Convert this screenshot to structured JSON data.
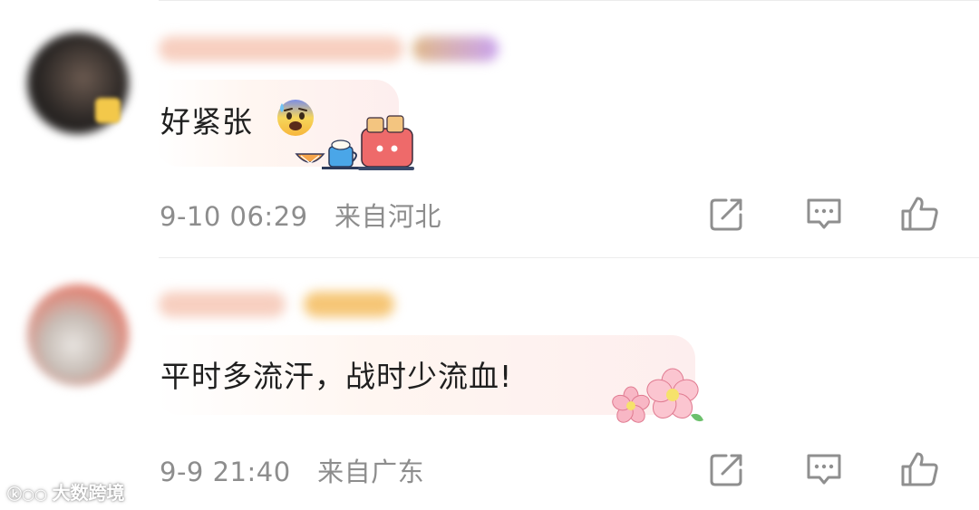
{
  "comments": [
    {
      "text": "好紧张",
      "emoji": "anxious-face-sweat",
      "decoration": "toaster-breakfast-sticker",
      "timestamp": "9-10 06:29",
      "location": "来自河北"
    },
    {
      "text": "平时多流汗，战时少流血!",
      "decoration": "sakura-flowers-sticker",
      "timestamp": "9-9 21:40",
      "location": "来自广东"
    }
  ],
  "actions": [
    "share-icon",
    "comment-icon",
    "like-icon"
  ],
  "watermark": "大数跨境",
  "colors": {
    "text": "#1f1f1f",
    "meta": "#8d8d8d",
    "icon": "#8f8f8f",
    "bubble": "#fdeeee"
  }
}
